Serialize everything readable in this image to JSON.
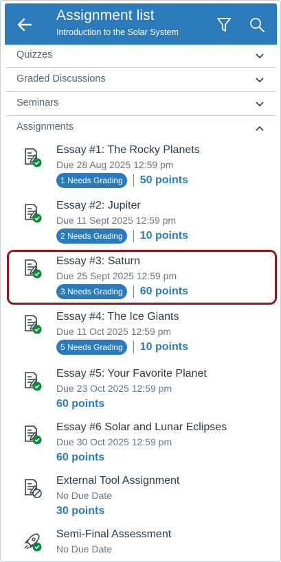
{
  "header": {
    "title": "Assignment list",
    "subtitle": "Introduction to the Solar System"
  },
  "sections": [
    {
      "label": "Quizzes",
      "state": "collapsed"
    },
    {
      "label": "Graded Discussions",
      "state": "collapsed"
    },
    {
      "label": "Seminars",
      "state": "collapsed"
    },
    {
      "label": "Assignments",
      "state": "expanded"
    }
  ],
  "assignments": [
    {
      "title": "Essay #1: The Rocky Planets",
      "due": "Due 28 Aug 2025 12:59 pm",
      "badge": "1 Needs Grading",
      "points": "50 points",
      "icon": "assignment-published-icon"
    },
    {
      "title": "Essay #2: Jupiter",
      "due": "Due 11 Sept 2025 12:59 pm",
      "badge": "2 Needs Grading",
      "points": "10 points",
      "icon": "assignment-published-icon"
    },
    {
      "title": "Essay #3: Saturn",
      "due": "Due 25 Sept 2025 12:59 pm",
      "badge": "3 Needs Grading",
      "points": "60 points",
      "icon": "assignment-published-icon"
    },
    {
      "title": "Essay #4: The Ice Giants",
      "due": "Due 11 Oct 2025 12:59 pm",
      "badge": "5 Needs Grading",
      "points": "10 points",
      "icon": "assignment-published-icon"
    },
    {
      "title": "Essay #5: Your Favorite Planet",
      "due": "Due 23 Oct 2025 12:59 pm",
      "points": "60 points",
      "icon": "assignment-published-icon"
    },
    {
      "title": "Essay #6 Solar and Lunar Eclipses",
      "due": "Due 30 Oct 2025 12:59 pm",
      "points": "60 points",
      "icon": "assignment-published-icon"
    },
    {
      "title": "External Tool Assignment",
      "due": "No Due Date",
      "points": "30 points",
      "icon": "external-tool-unpublished-icon"
    },
    {
      "title": "Semi-Final Assessment",
      "due": "No Due Date",
      "icon": "quiz-rocket-published-icon"
    }
  ],
  "colors": {
    "brand": "#2b7abc",
    "published": "#0b8a3c",
    "highlight": "#8b1a1a"
  }
}
